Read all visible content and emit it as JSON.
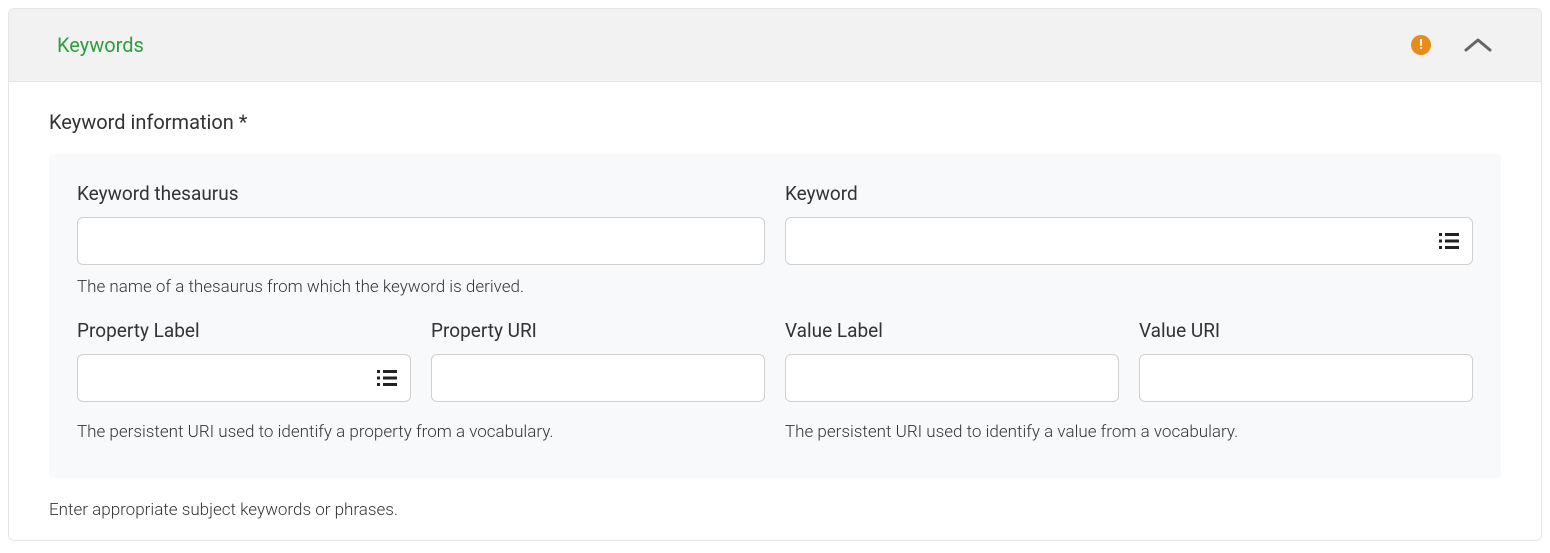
{
  "panel": {
    "title": "Keywords"
  },
  "section": {
    "title": "Keyword information *"
  },
  "fields": {
    "keyword_thesaurus": {
      "label": "Keyword thesaurus",
      "value": "",
      "help": "The name of a thesaurus from which the keyword is derived."
    },
    "keyword": {
      "label": "Keyword",
      "value": ""
    },
    "property_label": {
      "label": "Property Label",
      "value": ""
    },
    "property_uri": {
      "label": "Property URI",
      "value": ""
    },
    "value_label": {
      "label": "Value Label",
      "value": ""
    },
    "value_uri": {
      "label": "Value URI",
      "value": ""
    },
    "property_help": "The persistent URI used to identify a property from a vocabulary.",
    "value_help": "The persistent URI used to identify a value from a vocabulary."
  },
  "footer_help": "Enter appropriate subject keywords or phrases."
}
